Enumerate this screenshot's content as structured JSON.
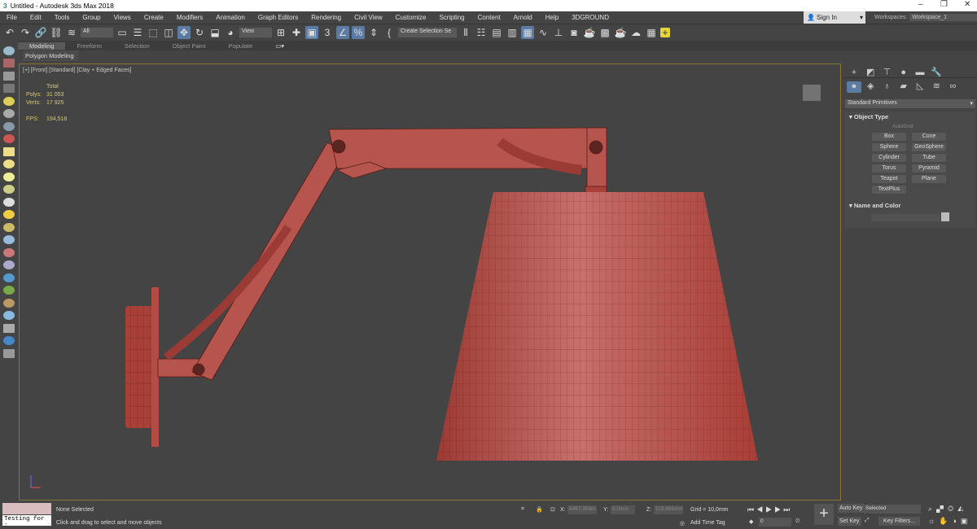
{
  "window": {
    "title": "Untitled - Autodesk 3ds Max 2018"
  },
  "menu": [
    "File",
    "Edit",
    "Tools",
    "Group",
    "Views",
    "Create",
    "Modifiers",
    "Animation",
    "Graph Editors",
    "Rendering",
    "Civil View",
    "Customize",
    "Scripting",
    "Content",
    "Arnold",
    "Help",
    "3DGROUND"
  ],
  "account": {
    "sign_in": "Sign In",
    "workspaces_label": "Workspaces:",
    "workspace": "Workspace_1"
  },
  "toolbar": {
    "selection_filter": "All",
    "ref_coord": "View",
    "named_selection": "Create Selection Se",
    "snap_label": "3"
  },
  "ribbon": {
    "tabs": [
      "Modeling",
      "Freeform",
      "Selection",
      "Object Paint",
      "Populate"
    ],
    "active": "Modeling",
    "panel": "Polygon Modeling"
  },
  "viewport": {
    "label": "[+] [Front] [Standard] [Clay + Edged Faces]",
    "stats": {
      "total": "Total",
      "polys_label": "Polys:",
      "polys": "31 053",
      "verts_label": "Verts:",
      "verts": "17 925",
      "fps_label": "FPS:",
      "fps": "194,518"
    },
    "model_color": "#b5463f"
  },
  "command_panel": {
    "category": "Standard Primitives",
    "object_type": "Object Type",
    "autogrid": "AutoGrid",
    "buttons": [
      "Box",
      "Cone",
      "Sphere",
      "GeoSphere",
      "Cylinder",
      "Tube",
      "Torus",
      "Pyramid",
      "Teapot",
      "Plane",
      "TextPlus"
    ],
    "name_and_color": "Name and Color"
  },
  "status": {
    "maxscript": "Testing for :",
    "selection": "None Selected",
    "prompt": "Click and drag to select and move objects",
    "x_label": "X:",
    "x": "8467,359m",
    "y_label": "Y:",
    "y": "0,0mm",
    "z_label": "Z:",
    "z": "113,656mm",
    "grid": "Grid = 10,0mm",
    "add_time_tag": "Add Time Tag",
    "frame": "0",
    "auto_key": "Auto Key",
    "set_key": "Set Key",
    "key_mode": "Selected",
    "key_filters": "Key Filters..."
  }
}
